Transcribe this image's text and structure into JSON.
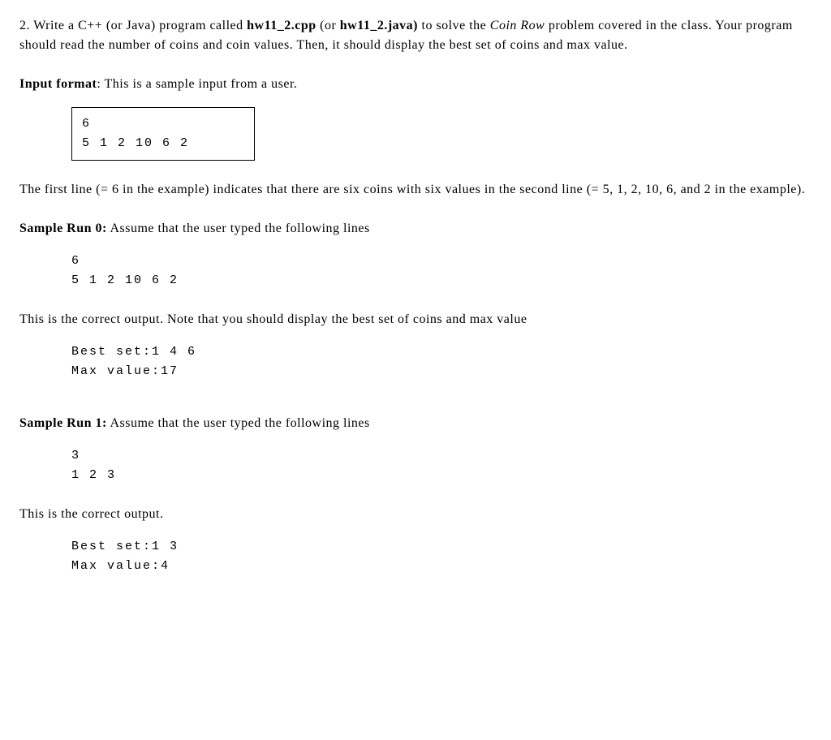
{
  "problem": {
    "number": "2. ",
    "intro1": "Write a C++ (or Java) program called ",
    "filename1": "hw11_2.cpp",
    "intro2": " (or ",
    "filename2": "hw11_2.java)",
    "intro3": " to solve the ",
    "problem_name": "Coin Row",
    "intro4": " problem covered in the class. Your program should read the number of coins and coin values. Then, it should display the best set of coins and max value."
  },
  "input_format": {
    "label": "Input format",
    "text": ": This is a sample input from a user.",
    "box_line1": "6",
    "box_line2": "5 1 2 10 6 2"
  },
  "explanation": "The first line (= 6 in the example) indicates that there are six coins with six values in the second line (= 5, 1, 2, 10, 6, and 2 in the example).",
  "sample_run_0": {
    "label": "Sample Run 0:",
    "text": " Assume that the user typed the following lines",
    "input_line1": "6",
    "input_line2": "5 1 2 10 6 2",
    "output_intro": "This is the correct output. Note that you should display the best set of coins and max value",
    "output_line1": "Best set:1 4 6",
    "output_line2": "Max value:17"
  },
  "sample_run_1": {
    "label": "Sample Run 1:",
    "text": " Assume that the user typed the following lines",
    "input_line1": "3",
    "input_line2": "1 2 3",
    "output_intro": "This is the correct output.",
    "output_line1": "Best set:1 3",
    "output_line2": "Max value:4"
  }
}
